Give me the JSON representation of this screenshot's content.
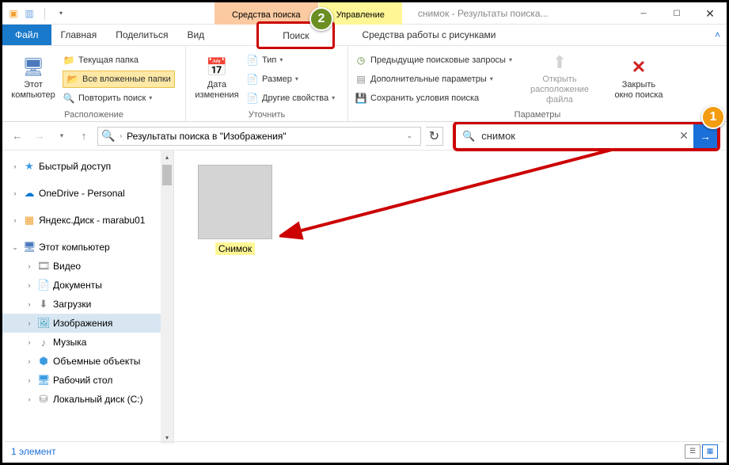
{
  "window": {
    "title": "снимок - Результаты поиска..."
  },
  "context_tabs": {
    "search_tools": "Средства поиска",
    "manage": "Управление"
  },
  "menu": {
    "file": "Файл",
    "home": "Главная",
    "share": "Поделиться",
    "view": "Вид",
    "search": "Поиск",
    "picture_tools": "Средства работы с рисунками"
  },
  "ribbon": {
    "location": {
      "this_pc": "Этот\nкомпьютер",
      "current_folder": "Текущая папка",
      "all_subfolders": "Все вложенные папки",
      "search_again": "Повторить поиск",
      "label": "Расположение"
    },
    "refine": {
      "date_modified": "Дата\nизменения",
      "type": "Тип",
      "size": "Размер",
      "other_props": "Другие свойства",
      "label": "Уточнить"
    },
    "options": {
      "recent": "Предыдущие поисковые запросы",
      "advanced": "Дополнительные параметры",
      "save": "Сохранить условия поиска",
      "open_location": "Открыть\nрасположение файла",
      "close_search": "Закрыть\nокно поиска",
      "label": "Параметры"
    }
  },
  "nav": {
    "breadcrumb": "Результаты поиска в \"Изображения\""
  },
  "search": {
    "value": "снимок"
  },
  "tree": {
    "quick_access": "Быстрый доступ",
    "onedrive": "OneDrive - Personal",
    "yandex": "Яндекс.Диск - marabu01",
    "this_pc": "Этот компьютер",
    "videos": "Видео",
    "documents": "Документы",
    "downloads": "Загрузки",
    "pictures": "Изображения",
    "music": "Музыка",
    "objects3d": "Объемные объекты",
    "desktop": "Рабочий стол",
    "local_disk": "Локальный диск (C:)"
  },
  "result": {
    "filename": "Снимок"
  },
  "status": {
    "count": "1 элемент"
  },
  "annotations": {
    "one": "1",
    "two": "2"
  }
}
